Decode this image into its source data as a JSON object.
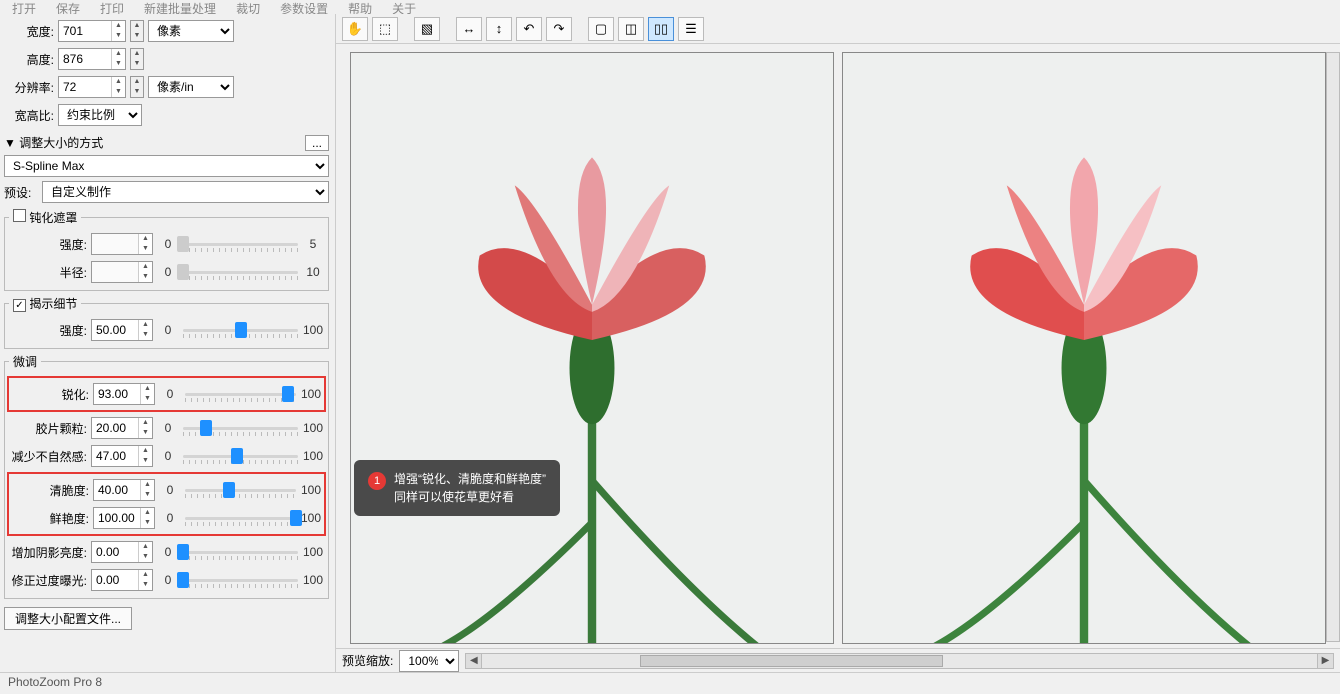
{
  "menu": {
    "items": [
      "打开",
      "保存",
      "打印",
      "新建批量处理",
      "裁切",
      "参数设置",
      "帮助",
      "关于"
    ]
  },
  "size": {
    "width_label": "宽度:",
    "width": "701",
    "height_label": "高度:",
    "height": "876",
    "res_label": "分辨率:",
    "res": "72",
    "unit_px": "像素",
    "unit_res": "像素/in",
    "aspect_label": "宽高比:",
    "aspect_value": "约束比例"
  },
  "resize": {
    "section": "调整大小的方式",
    "method": "S-Spline Max",
    "preset_label": "预设:",
    "preset_value": "自定义制作"
  },
  "unsharp": {
    "title": "钝化遮罩",
    "checked": false,
    "strength_label": "强度:",
    "strength": "",
    "min": "0",
    "max": "5",
    "radius_label": "半径:",
    "radius": "",
    "rmin": "0",
    "rmax": "10"
  },
  "reveal": {
    "title": "揭示细节",
    "checked": true,
    "strength_label": "强度:",
    "strength": "50.00",
    "min": "0",
    "max": "100"
  },
  "fine": {
    "title": "微调",
    "sharpen_label": "锐化:",
    "sharpen": "93.00",
    "grain_label": "胶片颗粒:",
    "grain": "20.00",
    "artifact_label": "减少不自然感:",
    "artifact": "47.00",
    "crisp_label": "清脆度:",
    "crisp": "40.00",
    "vivid_label": "鲜艳度:",
    "vivid": "100.00",
    "shadow_label": "增加阴影亮度:",
    "shadow": "0.00",
    "exposure_label": "修正过度曝光:",
    "exposure": "0.00",
    "min": "0",
    "max": "100"
  },
  "profile_btn": "调整大小配置文件...",
  "bottom": {
    "zoom_label": "预览缩放:",
    "zoom_value": "100%"
  },
  "status": "PhotoZoom Pro 8",
  "callout": {
    "num": "1",
    "line1": "增强“锐化、清脆度和鲜艳度”",
    "line2": "同样可以使花草更好看"
  },
  "dots": "..."
}
